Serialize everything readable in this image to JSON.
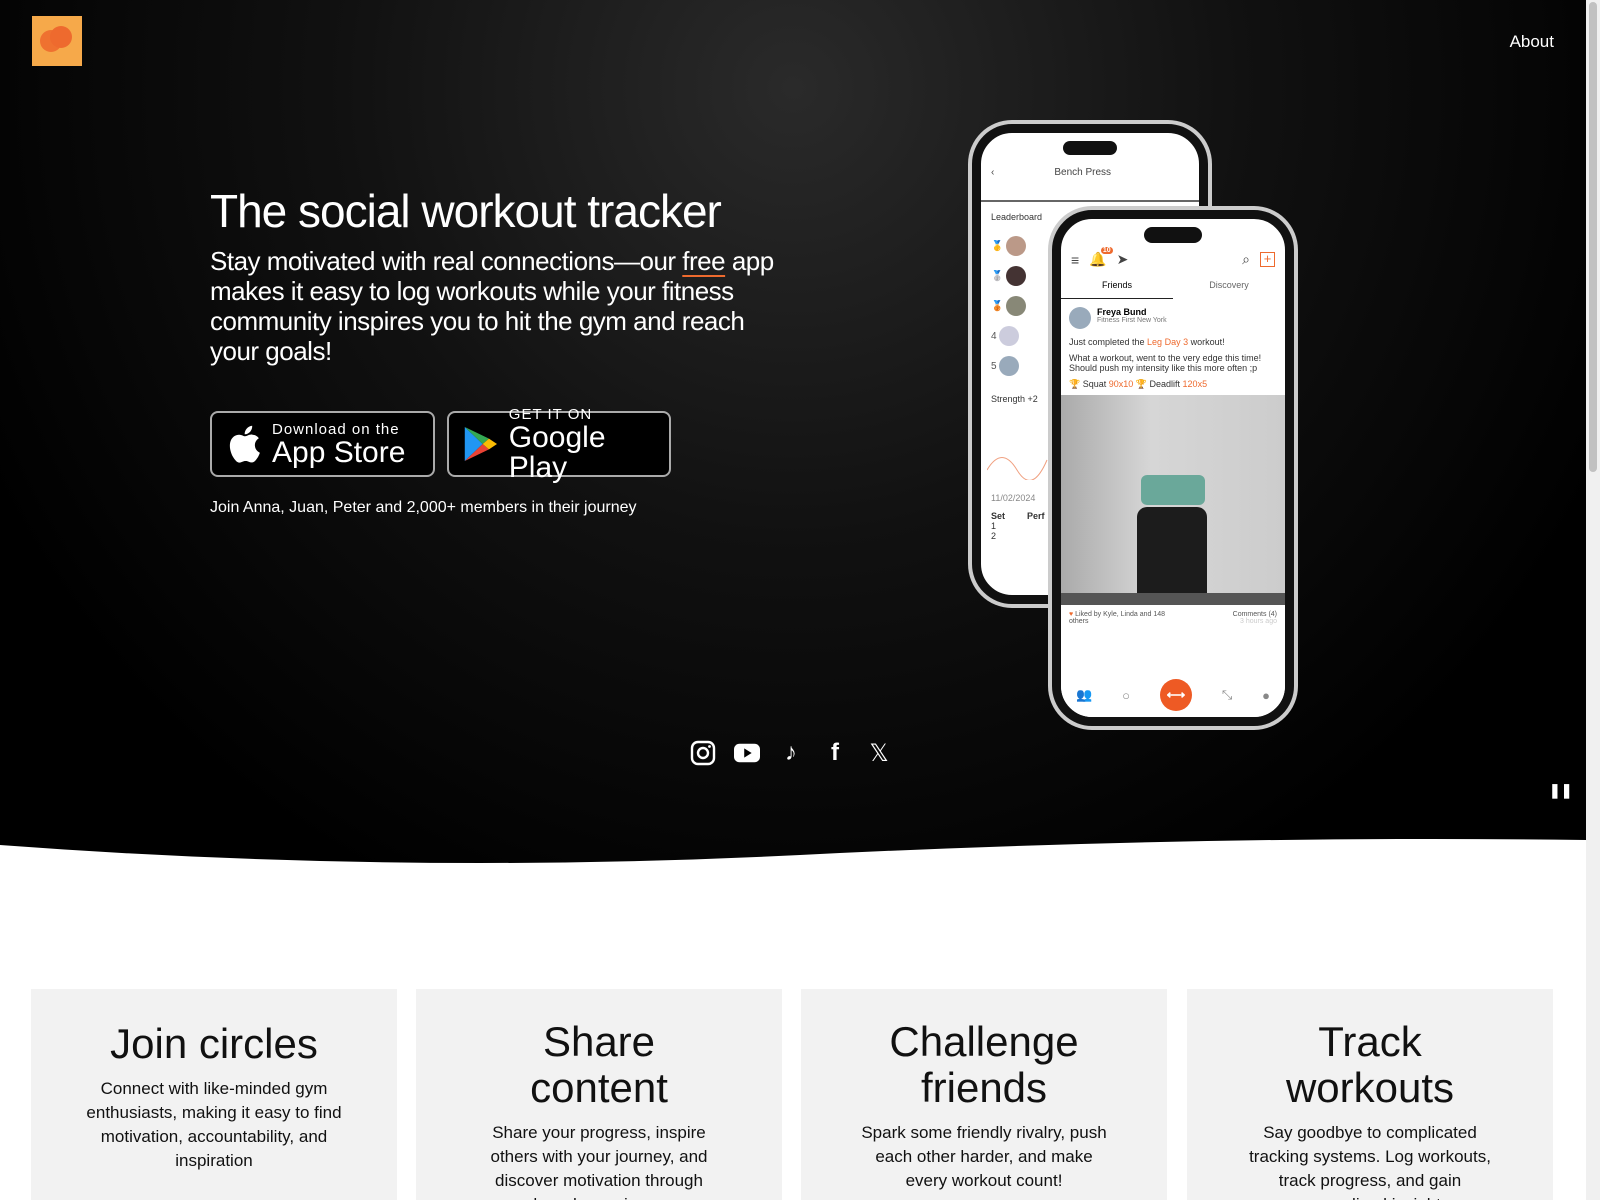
{
  "nav": {
    "about": "About"
  },
  "hero": {
    "title": "The social workout tracker",
    "subtitle_pre": "Stay motivated with real connections—our ",
    "subtitle_free": "free",
    "subtitle_post": " app makes it easy to log workouts while your fitness community inspires you to hit the gym and reach your goals!",
    "app_store": {
      "small": "Download on the",
      "big": "App Store"
    },
    "google_play": {
      "small": "GET IT ON",
      "big": "Google Play"
    },
    "join": "Join Anna, Juan, Peter and 2,000+ members in their journey"
  },
  "phone_back": {
    "title": "Bench Press",
    "leaderboard": "Leaderboard",
    "ranks": [
      "4",
      "5"
    ],
    "strength": "Strength +2",
    "date": "11/02/2024",
    "set_header": "Set",
    "perf_header": "Perf",
    "sets": [
      "1",
      "2"
    ]
  },
  "phone_front": {
    "tabs": [
      "Friends",
      "Discovery"
    ],
    "badge": "10",
    "user": "Freya Bund",
    "gym": "Fitness First New York",
    "post_pre": "Just completed the ",
    "post_workout": "Leg Day 3",
    "post_post": " workout!",
    "body": "What a workout, went to the very edge this time! Should push my intensity like this more often ;p",
    "lift1": "Squat",
    "lift1_val": "90x10",
    "lift2": "Deadlift",
    "lift2_val": "120x5",
    "likes": "Liked by Kyle, Linda and 148 others",
    "comments": "Comments (4)",
    "time": "3 hours ago"
  },
  "social": [
    "instagram-icon",
    "youtube-icon",
    "tiktok-icon",
    "facebook-icon",
    "x-icon"
  ],
  "features": [
    {
      "title": "Join circles",
      "text": "Connect with like-minded gym enthusiasts, making it easy to find motivation, accountability, and inspiration"
    },
    {
      "title": "Share content",
      "text": "Share your progress, inspire others with your journey, and discover motivation through shared experiences"
    },
    {
      "title": "Challenge friends",
      "text": "Spark some friendly rivalry, push each other harder, and make every workout count!"
    },
    {
      "title": "Track workouts",
      "text": "Say goodbye to complicated tracking systems. Log workouts, track progress, and gain personalized insights"
    }
  ],
  "colors": {
    "accent": "#ee6a2e",
    "logo_bg": "#f6a94a"
  }
}
